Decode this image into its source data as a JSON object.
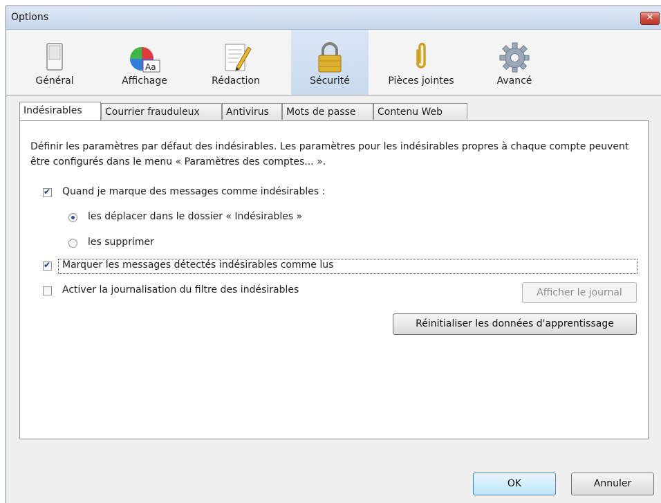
{
  "window": {
    "title": "Options",
    "close_glyph": "✕"
  },
  "toolbar": {
    "panes": [
      {
        "label": "Général",
        "icon": "switch-icon"
      },
      {
        "label": "Affichage",
        "icon": "color-wheel-font-icon"
      },
      {
        "label": "Rédaction",
        "icon": "document-pencil-icon"
      },
      {
        "label": "Sécurité",
        "icon": "padlock-icon",
        "selected": true
      },
      {
        "label": "Pièces jointes",
        "icon": "paperclip-icon"
      },
      {
        "label": "Avancé",
        "icon": "gear-icon"
      }
    ]
  },
  "tabs": [
    {
      "label": "Indésirables",
      "active": true
    },
    {
      "label": "Courrier frauduleux"
    },
    {
      "label": "Antivirus"
    },
    {
      "label": "Mots de passe"
    },
    {
      "label": "Contenu Web"
    }
  ],
  "junk": {
    "description": "Définir les paramètres par défaut des indésirables. Les paramètres pour les indésirables propres à chaque compte peuvent être configurés dans le menu « Paramètres des comptes... ».",
    "mark_action": {
      "label": "Quand je marque des messages comme indésirables :",
      "checked": true
    },
    "move_option": {
      "label": "les déplacer dans le dossier « Indésirables »",
      "selected": true
    },
    "delete_option": {
      "label": "les supprimer",
      "selected": false
    },
    "mark_read": {
      "label": "Marquer les messages détectés indésirables comme lus",
      "checked": true
    },
    "enable_logging": {
      "label": "Activer la journalisation du filtre des indésirables",
      "checked": false
    },
    "show_log_button": "Afficher le journal",
    "reset_button": "Réinitialiser les données d'apprentissage"
  },
  "footer": {
    "ok": "OK",
    "cancel": "Annuler"
  }
}
